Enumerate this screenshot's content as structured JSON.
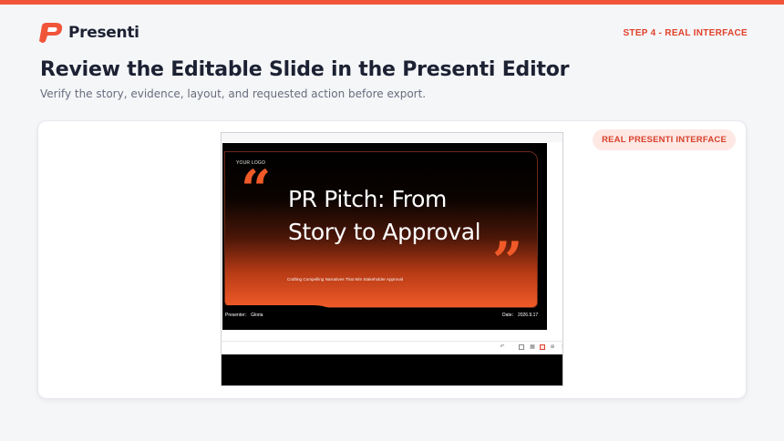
{
  "brand": {
    "name": "Presenti",
    "accent": "#f0553a",
    "logo_icon": "presenti-logo-icon"
  },
  "header": {
    "step_label": "STEP 4 - REAL INTERFACE"
  },
  "page": {
    "title": "Review the Editable Slide in the Presenti Editor",
    "subtitle": "Verify the story, evidence, layout, and requested action before export."
  },
  "card": {
    "badge": "REAL PRESENTI INTERFACE"
  },
  "slide": {
    "logo_text": "YOUR LOGO",
    "title_line1": "PR Pitch: From",
    "title_line2": "Story to Approval",
    "subtitle": "Crafting Compelling Narratives That Win Stakeholder Approval",
    "presenter": "Presenter： Gloria",
    "date": "Date： 2026.9.17",
    "quote_open": "“",
    "quote_close": "”"
  },
  "toolbar": {
    "icons": [
      "undo-icon",
      "layout-icon",
      "grid-icon",
      "slide-view-icon",
      "add-icon",
      "more-icon"
    ]
  }
}
